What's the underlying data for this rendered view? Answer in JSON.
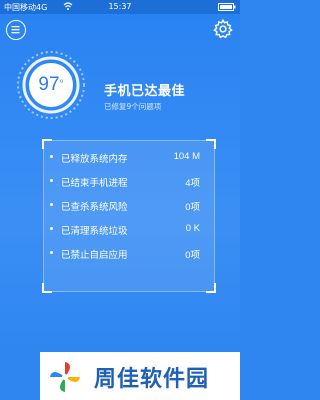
{
  "statusbar": {
    "carrier": "中国移动4G",
    "time": "15:37"
  },
  "header": {
    "menu_icon": "menu-icon",
    "settings_icon": "gear-icon"
  },
  "score": {
    "value": "97",
    "unit": "°"
  },
  "summary": {
    "title": "手机已达最佳",
    "subtitle": "已修复9个问题项"
  },
  "results": [
    {
      "label": "已释放系统内存",
      "value": "104 M"
    },
    {
      "label": "已结束手机进程",
      "value": "4项"
    },
    {
      "label": "已查杀系统风险",
      "value": "0项"
    },
    {
      "label": "已清理系统垃圾",
      "value": "0 K"
    },
    {
      "label": "已禁止自启应用",
      "value": "0项"
    }
  ],
  "watermark": {
    "text": "周佳软件园",
    "logo_icon": "pinwheel-logo-icon"
  },
  "colors": {
    "primary": "#2f86f0",
    "text": "#ffffff",
    "brand_text": "#1e5fb8"
  }
}
